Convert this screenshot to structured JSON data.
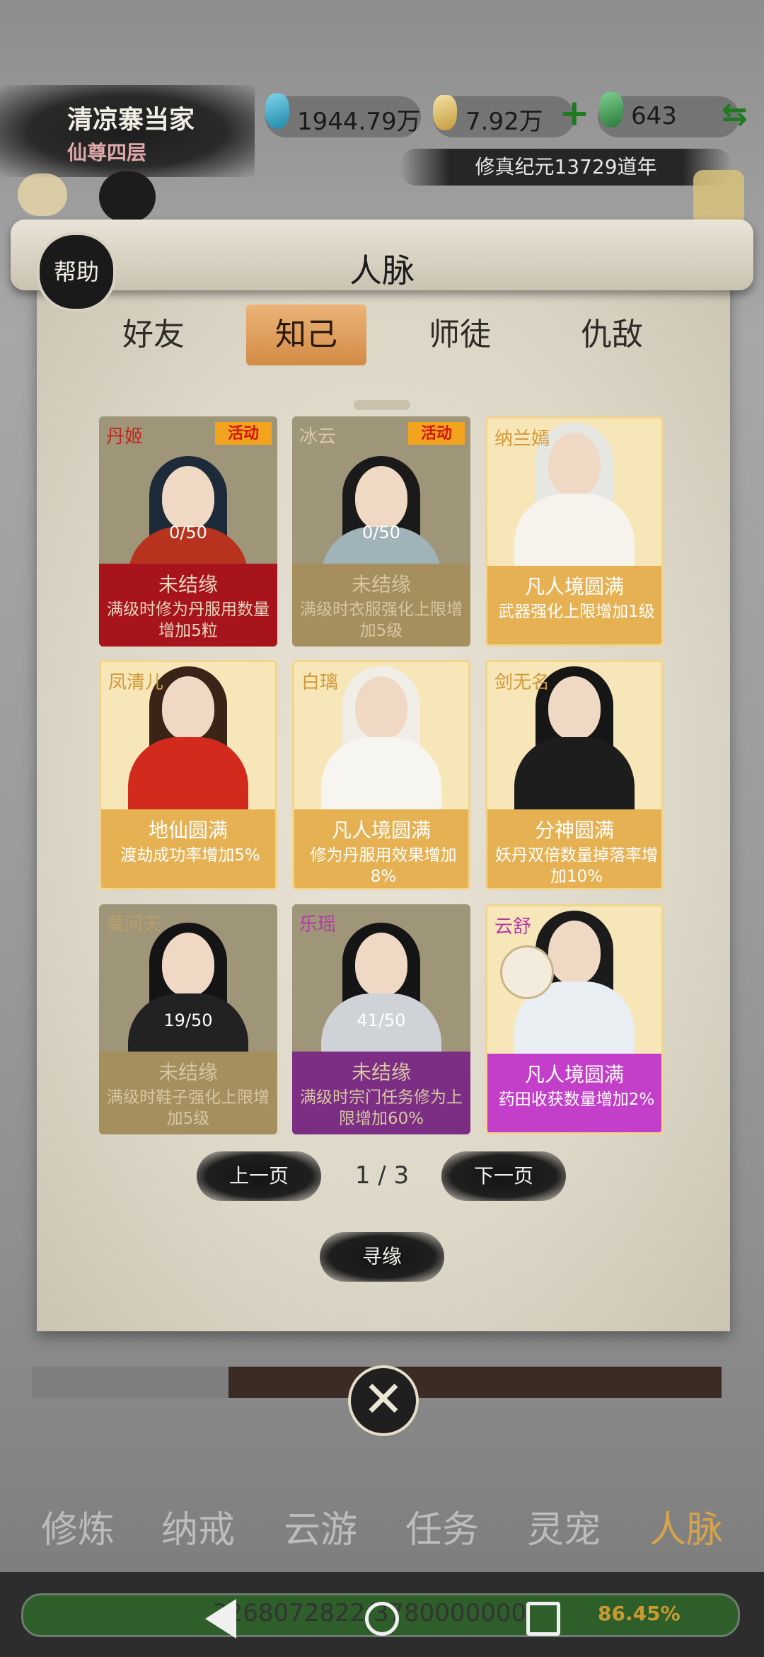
{
  "player": {
    "name": "清凉寨当家",
    "rank": "仙尊四层"
  },
  "resources": {
    "spirit_stones": "1944.79万",
    "gold": "7.92万",
    "add_symbol": "+",
    "jade": "643",
    "exchange_symbol": "⇆"
  },
  "era": "修真纪元13729道年",
  "dialog": {
    "help_label": "帮助",
    "title": "人脉",
    "tabs": [
      {
        "label": "好友"
      },
      {
        "label": "知己"
      },
      {
        "label": "师徒"
      },
      {
        "label": "仇敌"
      }
    ],
    "cards": [
      {
        "name": "丹姬",
        "badge": "活动",
        "progress": "0/50",
        "status": "未结缘",
        "effect": "满级时修为丹服用数量增加5粒"
      },
      {
        "name": "冰云",
        "badge": "活动",
        "progress": "0/50",
        "status": "未结缘",
        "effect": "满级时衣服强化上限增加5级"
      },
      {
        "name": "纳兰嫣",
        "status": "凡人境圆满",
        "effect": "武器强化上限增加1级"
      },
      {
        "name": "凤清儿",
        "status": "地仙圆满",
        "effect": "渡劫成功率增加5%"
      },
      {
        "name": "白璃",
        "status": "凡人境圆满",
        "effect": "修为丹服用效果增加8%"
      },
      {
        "name": "剑无名",
        "status": "分神圆满",
        "effect": "妖丹双倍数量掉落率增加10%"
      },
      {
        "name": "莫问天",
        "progress": "19/50",
        "status": "未结缘",
        "effect": "满级时鞋子强化上限增加5级"
      },
      {
        "name": "乐瑶",
        "progress": "41/50",
        "status": "未结缘",
        "effect": "满级时宗门任务修为上限增加60%"
      },
      {
        "name": "云舒",
        "status": "凡人境圆满",
        "effect": "药田收获数量增加2%"
      }
    ],
    "pager": {
      "prev": "上一页",
      "page": "1 / 3",
      "next": "下一页"
    },
    "seek_button": "寻缘",
    "close_symbol": "✕"
  },
  "bottom_nav": [
    {
      "label": "修炼"
    },
    {
      "label": "纳戒"
    },
    {
      "label": "云游"
    },
    {
      "label": "任务"
    },
    {
      "label": "灵宠"
    },
    {
      "label": "人脉"
    }
  ],
  "exp_bar": {
    "text": "3268072822/3780000000",
    "percent": "86.45%",
    "fraction": 0.8645
  }
}
